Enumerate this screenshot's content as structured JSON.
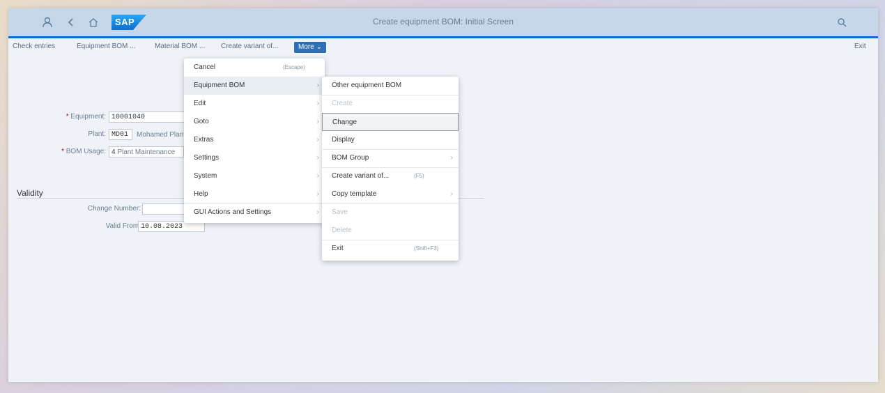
{
  "window": {
    "title": "Create equipment BOM: Initial Screen"
  },
  "shell": {
    "logo": "SAP",
    "icons": [
      "user-icon",
      "back-icon",
      "home-icon",
      "search-icon"
    ]
  },
  "toolbar": {
    "check_entries": "Check entries",
    "equipment_bom": "Equipment BOM ...",
    "material_bom": "Material BOM ...",
    "create_variant": "Create variant of...",
    "more": "More",
    "exit": "Exit"
  },
  "form": {
    "equipment": {
      "label": "Equipment:",
      "value": "10001040"
    },
    "plant": {
      "label": "Plant:",
      "value": "MD01",
      "desc": "Mohamed Plant"
    },
    "bom_usage": {
      "label": "BOM Usage:",
      "value": "4",
      "desc": "Plant Maintenance"
    },
    "validity_title": "Validity",
    "change_number": {
      "label": "Change Number:",
      "value": ""
    },
    "valid_from": {
      "label": "Valid From:",
      "value": "10.08.2023"
    }
  },
  "menu_more": [
    {
      "label": "Cancel",
      "shortcut": "(Escape)"
    },
    {
      "label": "Equipment BOM",
      "submenu": true
    },
    {
      "label": "Edit",
      "submenu": true
    },
    {
      "label": "Goto",
      "submenu": true
    },
    {
      "label": "Extras",
      "submenu": true
    },
    {
      "label": "Settings",
      "submenu": true
    },
    {
      "label": "System",
      "submenu": true
    },
    {
      "label": "Help",
      "submenu": true
    },
    {
      "label": "GUI Actions and Settings",
      "submenu": true
    }
  ],
  "menu_equipment_bom": [
    {
      "label": "Other equipment BOM"
    },
    {
      "label": "Create",
      "disabled": true
    },
    {
      "label": "Change"
    },
    {
      "label": "Display"
    },
    {
      "label": "BOM Group",
      "submenu": true
    },
    {
      "label": "Create variant of...",
      "shortcut": "(F5)"
    },
    {
      "label": "Copy template",
      "submenu": true
    },
    {
      "label": "Save",
      "disabled": true
    },
    {
      "label": "Delete",
      "disabled": true
    },
    {
      "label": "Exit",
      "shortcut": "(Shift+F3)"
    }
  ],
  "colors": {
    "accent": "#0a6ed1",
    "shell": "#c6d7ea",
    "more_button": "#2f6fb3",
    "required": "#bb0000"
  }
}
